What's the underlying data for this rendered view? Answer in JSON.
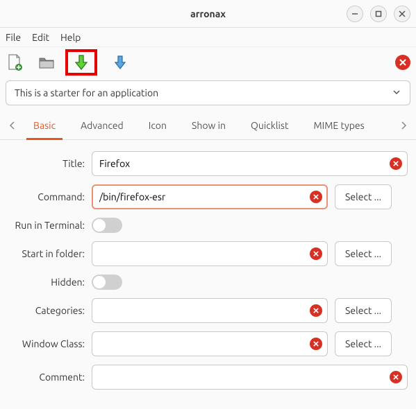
{
  "window": {
    "title": "arronax"
  },
  "menubar": {
    "file": "File",
    "edit": "Edit",
    "help": "Help"
  },
  "starter_text": "This is a starter for an application",
  "tabs": {
    "basic": "Basic",
    "advanced": "Advanced",
    "icon": "Icon",
    "showin": "Show in",
    "quicklist": "Quicklist",
    "mimetypes": "MIME types"
  },
  "labels": {
    "title": "Title:",
    "command": "Command:",
    "run_in_terminal": "Run in Terminal:",
    "start_in_folder": "Start in folder:",
    "hidden": "Hidden:",
    "categories": "Categories:",
    "window_class": "Window Class:",
    "comment": "Comment:"
  },
  "values": {
    "title": "Firefox",
    "command": "/bin/firefox-esr",
    "start_in_folder": "",
    "categories": "",
    "window_class": "",
    "comment": ""
  },
  "buttons": {
    "select": "Select ..."
  }
}
